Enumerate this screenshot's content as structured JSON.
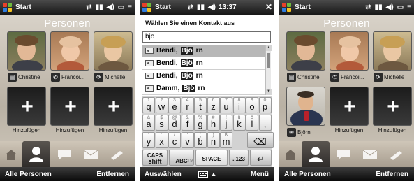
{
  "status": {
    "start": "Start",
    "time": "13:37",
    "icons": [
      "sync-icon",
      "signal-icon",
      "volume-icon",
      "battery-icon",
      "menu-icon"
    ]
  },
  "people": {
    "title": "Personen",
    "contacts": [
      {
        "name": "Christine",
        "icon": "business-card-icon"
      },
      {
        "name": "Francoi...",
        "icon": "phone-icon"
      },
      {
        "name": "Michelle",
        "icon": "phone-sync-icon"
      }
    ],
    "added_contact": {
      "name": "Björn",
      "icon": "envelope-icon"
    },
    "add_label": "Hinzufügen",
    "tabs": [
      "home-icon",
      "person-icon",
      "message-icon",
      "mail-icon",
      "pen-icon"
    ],
    "softkeys": {
      "left": "Alle Personen",
      "right": "Entfernen"
    }
  },
  "chooser": {
    "title": "Wählen Sie einen Kontakt aus",
    "search_value": "bjö",
    "results": [
      {
        "name": "Bendi, ",
        "match": "Bjö",
        "rest": "rn"
      },
      {
        "name": "Bendi, ",
        "match": "Bjö",
        "rest": "rn"
      },
      {
        "name": "Bendi, ",
        "match": "Bjö",
        "rest": "rn"
      },
      {
        "name": "Damm, ",
        "match": "Bjö",
        "rest": "rn"
      }
    ],
    "keyboard": {
      "row1": [
        {
          "k": "q",
          "a": "1"
        },
        {
          "k": "w",
          "a": "2"
        },
        {
          "k": "e",
          "a": "3"
        },
        {
          "k": "r",
          "a": "4"
        },
        {
          "k": "t",
          "a": "5"
        },
        {
          "k": "z",
          "a": "6"
        },
        {
          "k": "u",
          "a": "7"
        },
        {
          "k": "i",
          "a": "8"
        },
        {
          "k": "o",
          "a": "9"
        },
        {
          "k": "p",
          "a": "0"
        }
      ],
      "row2": [
        {
          "k": "a",
          "a": "ä"
        },
        {
          "k": "s",
          "a": "$"
        },
        {
          "k": "d",
          "a": "@"
        },
        {
          "k": "f",
          "a": "&"
        },
        {
          "k": "g",
          "a": "%"
        },
        {
          "k": "h",
          "a": "#"
        },
        {
          "k": "j",
          "a": "!"
        },
        {
          "k": "k",
          "a": "ü"
        },
        {
          "k": "l",
          "a": "ö"
        },
        {
          "k": ",",
          "a": "."
        }
      ],
      "row3": [
        {
          "k": "y",
          "a": "\""
        },
        {
          "k": "x",
          "a": "'"
        },
        {
          "k": "c",
          "a": "/"
        },
        {
          "k": "v",
          "a": ":"
        },
        {
          "k": "b",
          "a": "("
        },
        {
          "k": "n",
          "a": ")"
        },
        {
          "k": "m",
          "a": "ß"
        },
        {
          "k": "⌫",
          "a": ""
        }
      ],
      "row4": {
        "caps": "CAPS",
        "shift": "shift",
        "abc": "ABC",
        "t9": "T9",
        "space": "SPACE",
        "num": ".,123",
        "enter": "↵"
      }
    },
    "softkeys": {
      "left": "Auswählen",
      "right": "Menü",
      "input_arrow": "▲"
    }
  }
}
